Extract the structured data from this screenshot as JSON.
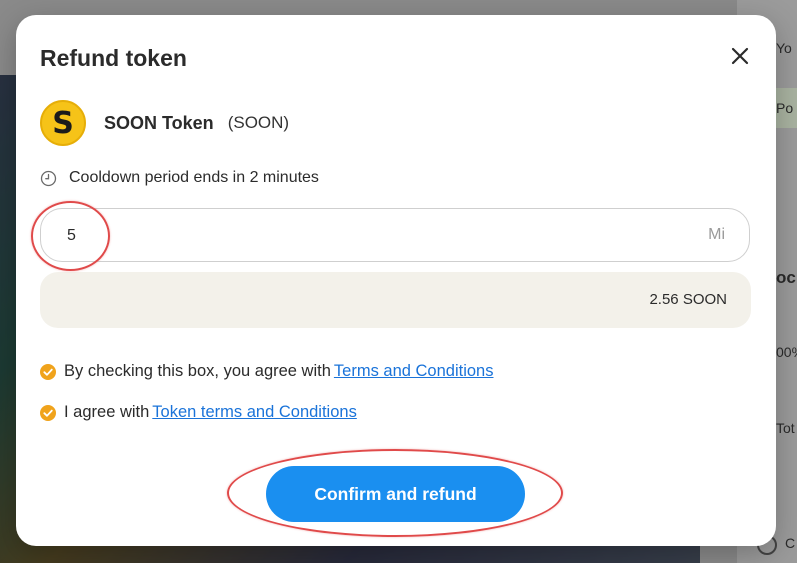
{
  "background": {
    "right_texts": [
      "Yo",
      "Po",
      "oc",
      "00%",
      "Tot",
      "C"
    ]
  },
  "modal": {
    "title": "Refund token",
    "close_icon": "close-icon"
  },
  "token": {
    "logo_letter": "S",
    "name": "SOON Token",
    "symbol": "(SOON)",
    "logo_color": "#f6c318"
  },
  "cooldown": {
    "icon": "clock-icon",
    "text": "Cooldown period ends in 2 minutes"
  },
  "amount": {
    "value": "5",
    "unit": "Mi"
  },
  "result": {
    "value": "2.56 SOON"
  },
  "agreements": [
    {
      "text": "By checking this box, you agree with",
      "link": "Terms and Conditions",
      "checked": true
    },
    {
      "text": "I agree with",
      "link": "Token terms and Conditions",
      "checked": true
    }
  ],
  "confirm_button": {
    "label": "Confirm and refund",
    "color": "#1a8ff0"
  },
  "colors": {
    "accent": "#1a8ff0",
    "link": "#1a73d9",
    "check": "#f0a31c",
    "annotation": "#e04a4a"
  }
}
